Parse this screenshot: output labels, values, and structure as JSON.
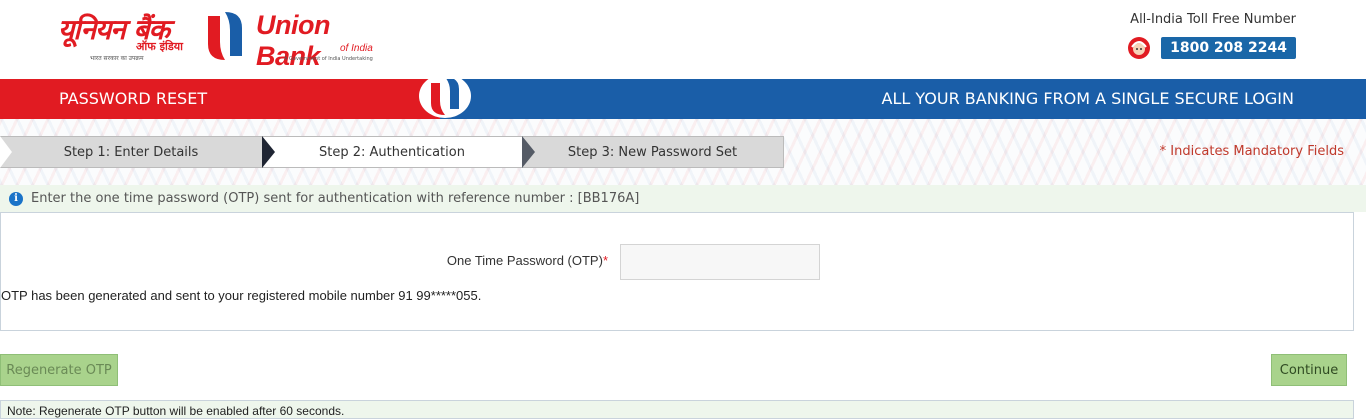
{
  "brand": {
    "hindi_name": "यूनियन बैंक",
    "hindi_sub": "ऑफ इंडिया",
    "hindi_tagline": "भारत सरकार का उपक्रम",
    "english_name": "Union Bank",
    "english_sub": "of India",
    "english_tagline": "A Government of India Undertaking",
    "logo_icon": "union-bank-logo-icon",
    "colors": {
      "red": "#e11b22",
      "blue": "#1a5ea8"
    }
  },
  "tollfree": {
    "label": "All-India Toll Free Number",
    "number": "1800 208 2244",
    "icon": "customer-care-icon"
  },
  "banner": {
    "title": "PASSWORD RESET",
    "tagline": "ALL YOUR BANKING FROM A SINGLE SECURE LOGIN"
  },
  "steps": [
    {
      "label": "Step 1: Enter Details",
      "state": "completed"
    },
    {
      "label": "Step 2: Authentication",
      "state": "active"
    },
    {
      "label": "Step 3: New Password Set",
      "state": "pending"
    }
  ],
  "mandatory_note": "* Indicates Mandatory Fields",
  "info": {
    "icon": "info-icon",
    "text": "Enter the one time password (OTP) sent for authentication with reference number : [BB176A]"
  },
  "form": {
    "otp_label": "One Time Password (OTP)",
    "required_marker": "*",
    "otp_value": "",
    "otp_message": "OTP has been generated and sent to your registered mobile number 91 99*****055."
  },
  "buttons": {
    "regenerate": "Regenerate OTP",
    "continue": "Continue"
  },
  "note": "Note: Regenerate OTP button will be enabled after 60 seconds."
}
